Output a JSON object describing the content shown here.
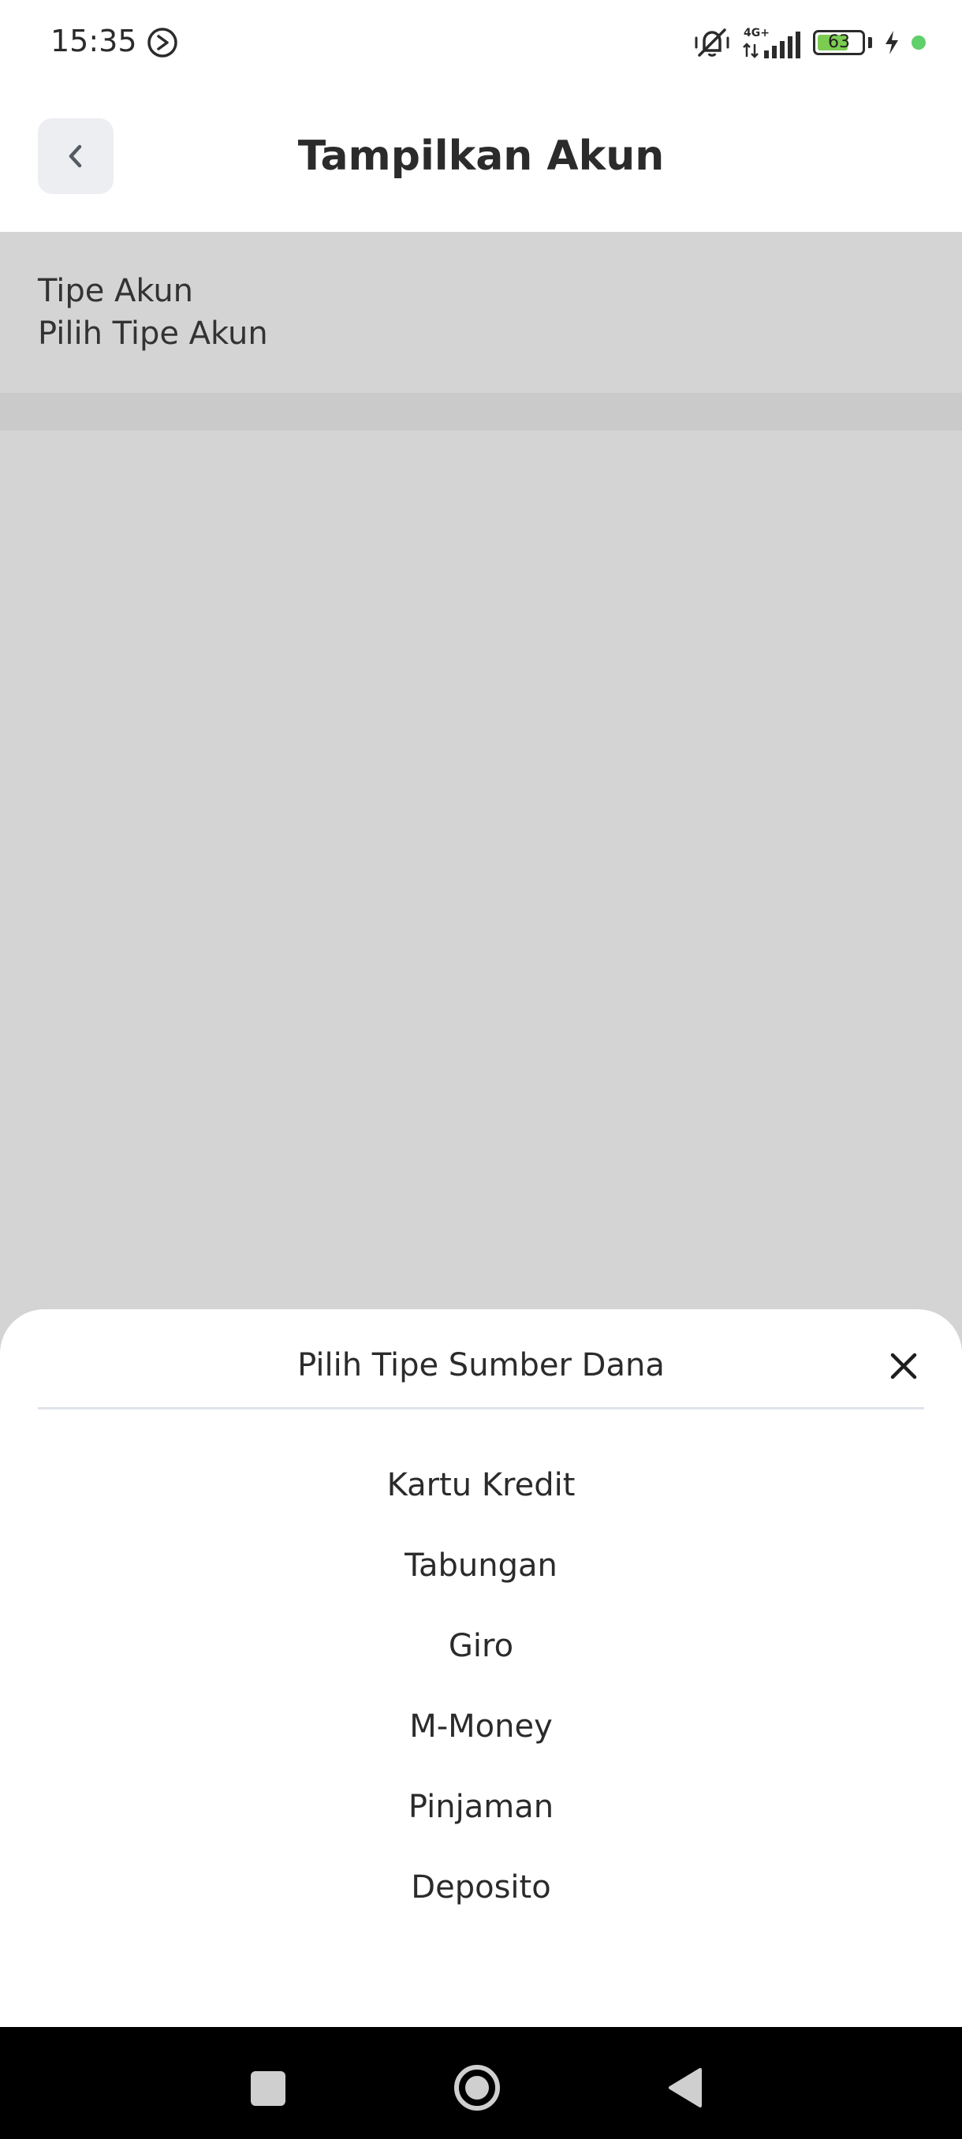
{
  "status_bar": {
    "time": "15:35",
    "network": "4G+",
    "battery_level": "63",
    "icons": [
      "play-circle-icon",
      "silent-icon",
      "signal-icon",
      "battery-icon",
      "charging-icon",
      "green-dot-icon"
    ]
  },
  "header": {
    "title": "Tampilkan Akun",
    "back_icon": "chevron-left-icon"
  },
  "account": {
    "label": "Tipe Akun",
    "value": "Pilih Tipe Akun"
  },
  "sheet": {
    "title": "Pilih Tipe Sumber Dana",
    "close_icon": "close-icon",
    "options": [
      "Kartu Kredit",
      "Tabungan",
      "Giro",
      "M-Money",
      "Pinjaman",
      "Deposito"
    ]
  },
  "nav": {
    "icons": [
      "recent-apps-icon",
      "home-icon",
      "back-icon"
    ]
  },
  "colors": {
    "overlay": "#d4d4d4",
    "battery_fill": "#7ccc52",
    "text": "#2b2b2b"
  }
}
